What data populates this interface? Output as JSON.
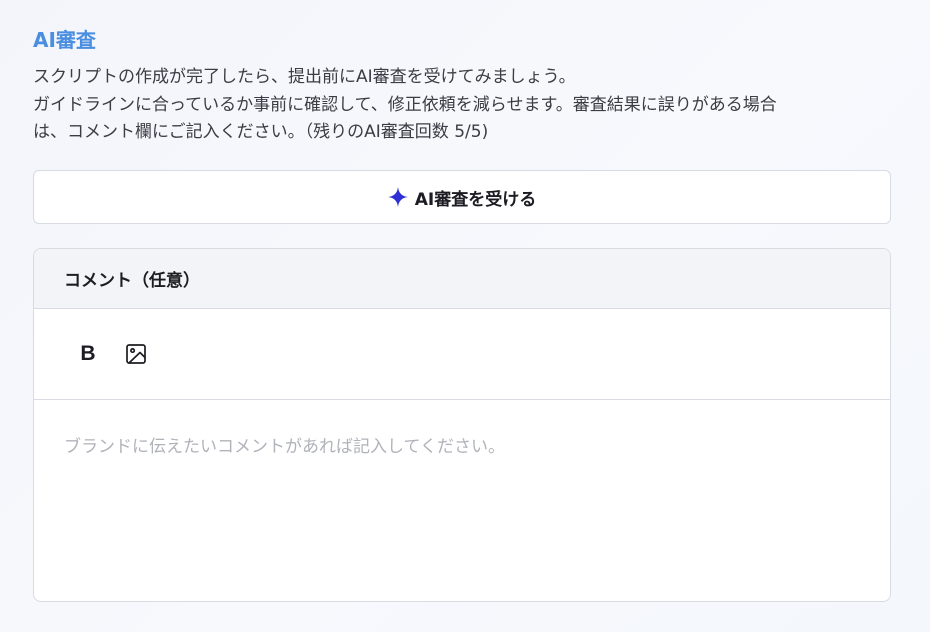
{
  "section": {
    "title": "AI審査",
    "description_lines": [
      "スクリプトの作成が完了したら、提出前にAI審査を受けてみましょう。",
      "ガイドラインに合っているか事前に確認して、修正依頼を減らせます。審査結果に誤りがある場合",
      "は、コメント欄にご記入ください。（残りのAI審査回数 5/5)"
    ]
  },
  "review_button": {
    "icon": "sparkle-icon",
    "label": "AI審査を受ける",
    "icon_color": "#2f2fd6"
  },
  "comment": {
    "header": "コメント（任意）",
    "toolbar": {
      "bold_label": "B",
      "bold_icon": "bold-icon",
      "image_icon": "image-icon"
    },
    "placeholder": "ブランドに伝えたいコメントがあれば記入してください。"
  },
  "colors": {
    "title": "#4a8ee0",
    "border": "#d8dbe2",
    "header_bg": "#f3f4f7",
    "placeholder": "#b1b3ba"
  }
}
